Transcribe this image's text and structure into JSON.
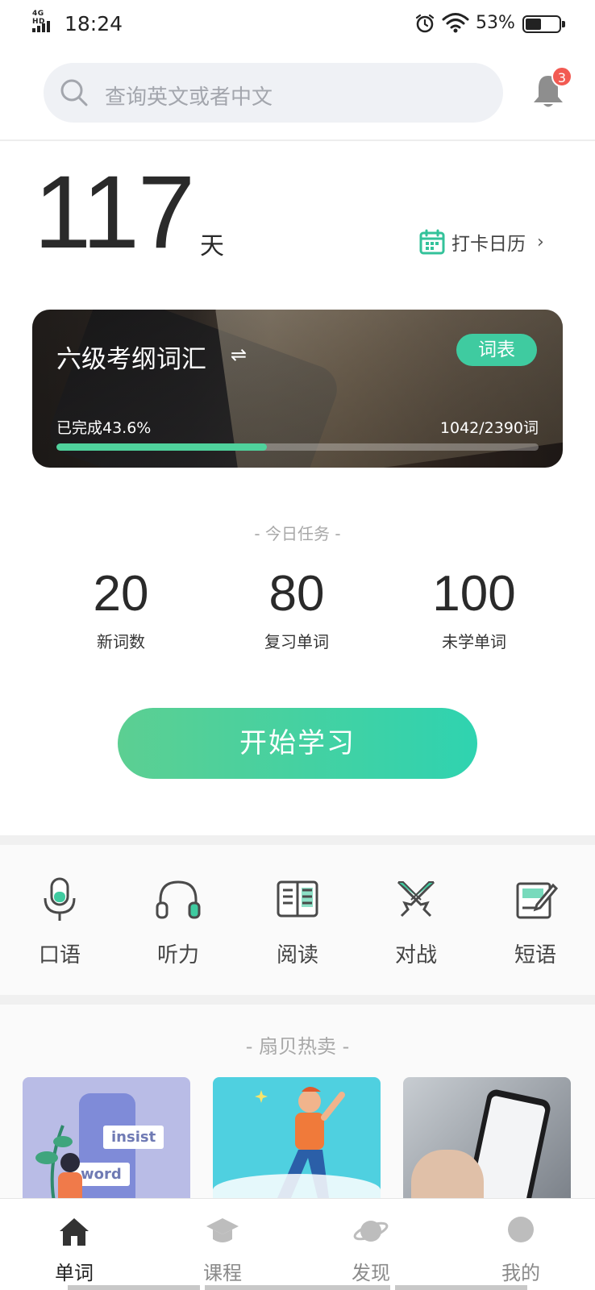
{
  "status_bar": {
    "network": "4G HD",
    "time": "18:24",
    "battery_percent": "53%",
    "battery_level": 0.53
  },
  "search": {
    "placeholder": "查询英文或者中文"
  },
  "notifications": {
    "badge_count": "3"
  },
  "streak": {
    "days": "117",
    "unit": "天",
    "calendar_label": "打卡日历"
  },
  "book": {
    "title": "六级考纲词汇",
    "swap_symbol": "⇌",
    "wordlist_label": "词表",
    "completion_text": "已完成43.6%",
    "progress_text": "1042/2390词",
    "progress_fraction": 0.436
  },
  "today_tasks": {
    "title": "- 今日任务 -",
    "items": [
      {
        "value": "20",
        "label": "新词数"
      },
      {
        "value": "80",
        "label": "复习单词"
      },
      {
        "value": "100",
        "label": "未学单词"
      }
    ]
  },
  "start_button": {
    "label": "开始学习"
  },
  "features": [
    {
      "label": "口语",
      "icon": "microphone-icon"
    },
    {
      "label": "听力",
      "icon": "headphones-icon"
    },
    {
      "label": "阅读",
      "icon": "open-book-icon"
    },
    {
      "label": "对战",
      "icon": "crossed-swords-icon"
    },
    {
      "label": "短语",
      "icon": "edit-note-icon"
    }
  ],
  "hot_sale": {
    "title": "- 扇贝热卖 -",
    "promo_words": [
      "insist",
      "word"
    ]
  },
  "tab_bar": {
    "items": [
      {
        "label": "单词",
        "icon": "home-icon",
        "active": true
      },
      {
        "label": "课程",
        "icon": "graduation-cap-icon",
        "active": false
      },
      {
        "label": "发现",
        "icon": "planet-icon",
        "active": false
      },
      {
        "label": "我的",
        "icon": "avatar-icon",
        "active": false
      }
    ]
  },
  "colors": {
    "accent_green": "#4fd29c",
    "badge_red": "#f25a52",
    "button_gradient_start": "#5ccf92",
    "button_gradient_end": "#2fd3b0"
  }
}
